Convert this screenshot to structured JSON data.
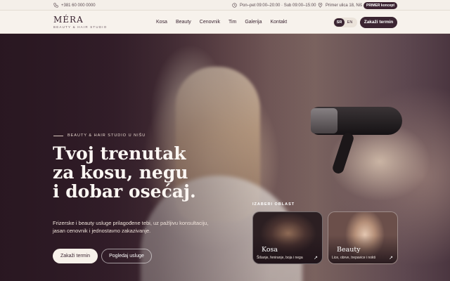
{
  "topbar": {
    "phone": "+381 60 000 0000",
    "hours": "Pon–pet 09:00–20:00 · Sub 09:00–15:00",
    "address": "Primer ulica 18, Niš",
    "badge": "PRIMER koncept"
  },
  "brand": {
    "name": "MÉRA",
    "tagline": "BEAUTY & HAIR STUDIO"
  },
  "nav": {
    "items": [
      "Kosa",
      "Beauty",
      "Cenovnik",
      "Tim",
      "Galerija",
      "Kontakt"
    ],
    "lang_active": "SR",
    "lang_other": "EN",
    "cta": "Zakaži termin"
  },
  "hero": {
    "kicker": "BEAUTY & HAIR STUDIO U NIŠU",
    "headline_1": "Tvoj trenutak",
    "headline_2": "za kosu, negu",
    "headline_3": "i dobar osećaj.",
    "lead": "Frizerske i beauty usluge prilagođene tebi, uz pažljivu konsultaciju, jasan cenovnik i jednostavno zakazivanje.",
    "primary_cta": "Zakaži termin",
    "secondary_cta": "Pogledaj usluge"
  },
  "areas": {
    "label": "IZABERI OBLAST",
    "cards": [
      {
        "title": "Kosa",
        "subtitle": "Šišanje, feniranje, boja i nega",
        "arrow": "↗"
      },
      {
        "title": "Beauty",
        "subtitle": "Lice, obrve, trepavice i nokti",
        "arrow": "↗"
      }
    ]
  },
  "colors": {
    "brand_dark": "#3b2532",
    "cream": "#f7f2ec"
  }
}
